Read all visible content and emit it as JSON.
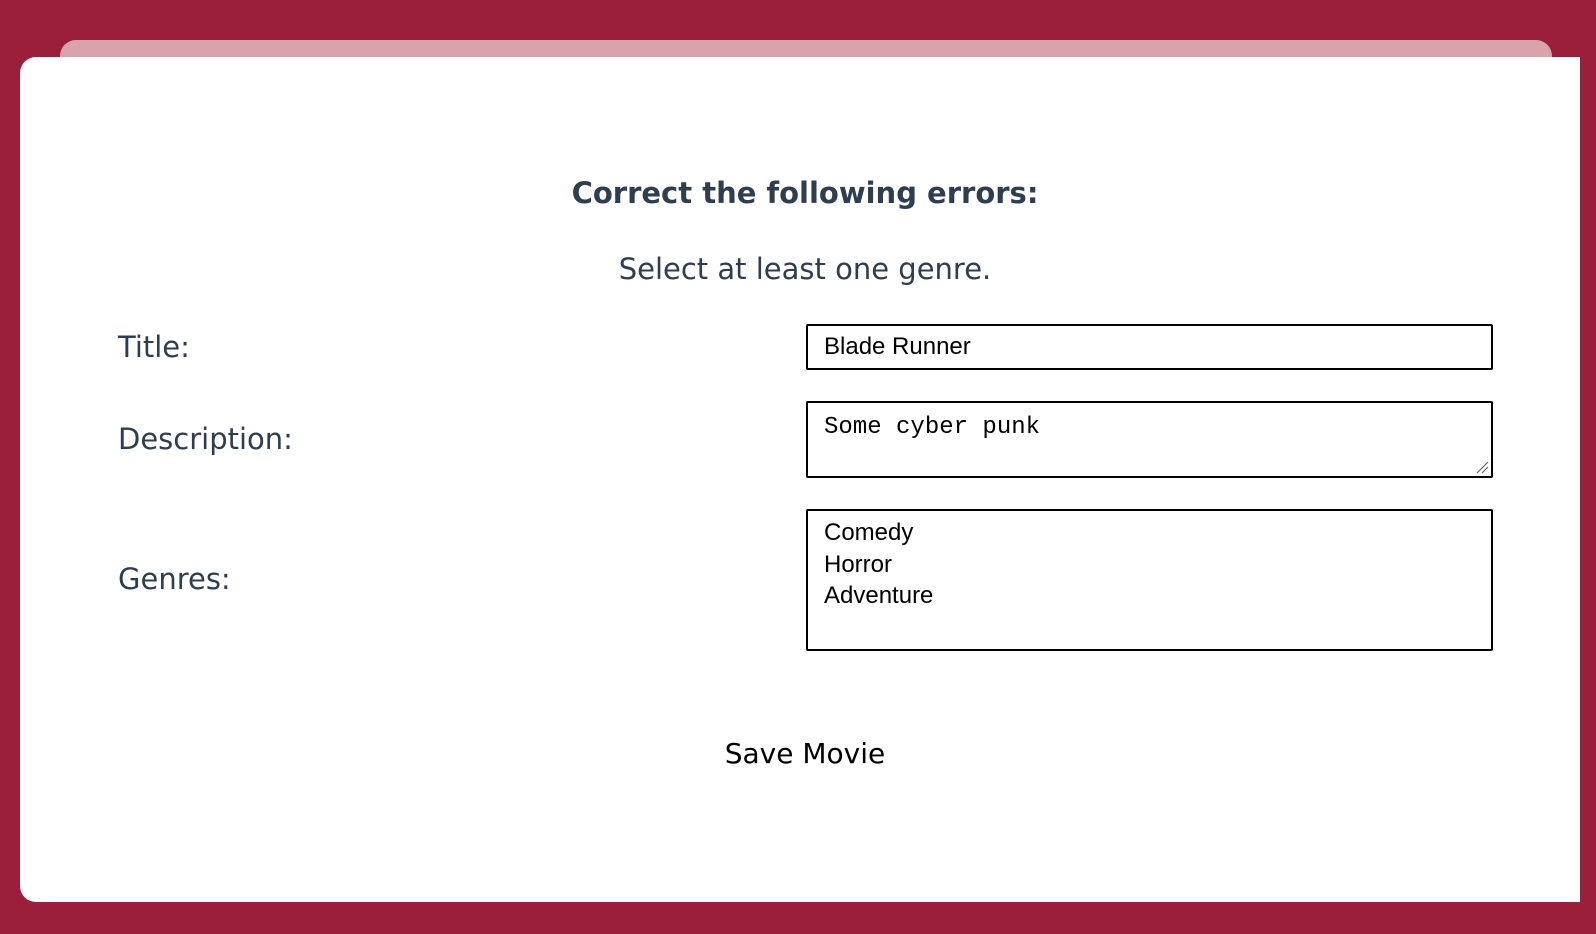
{
  "colors": {
    "background": "#9b1e3a",
    "back_card": "#d9a3ab",
    "card": "#ffffff",
    "text": "#2c3e50"
  },
  "errors": {
    "heading": "Correct the following errors:",
    "messages": [
      "Select at least one genre."
    ]
  },
  "form": {
    "title_label": "Title:",
    "title_value": "Blade Runner",
    "description_label": "Description:",
    "description_value": "Some cyber punk",
    "genres_label": "Genres:",
    "genres_options": [
      "Comedy",
      "Horror",
      "Adventure"
    ],
    "submit_label": "Save Movie"
  }
}
